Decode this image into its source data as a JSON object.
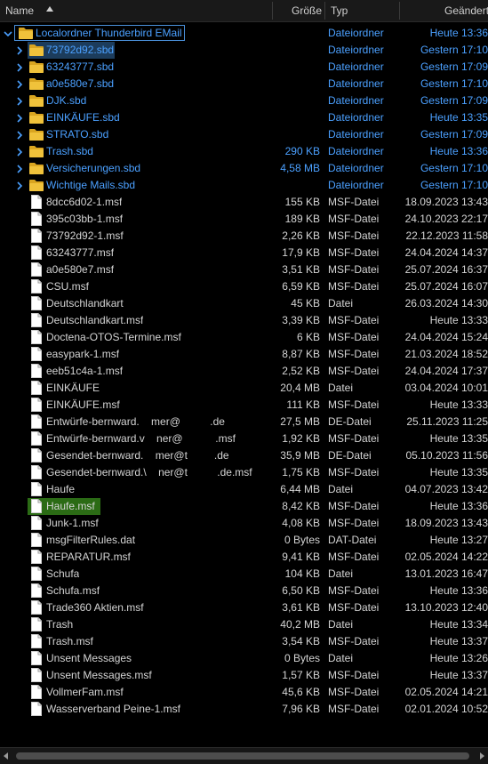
{
  "header": {
    "name": "Name",
    "size": "Größe",
    "type": "Typ",
    "modified": "Geändert"
  },
  "colors": {
    "folder": "#f0c23b",
    "folder_text": "#4ba0ff",
    "file_text": "#d4d4d4",
    "selection_green": "#2b6b15",
    "selection_blue": "#1c3c5c"
  },
  "rows": [
    {
      "name": "Localordner Thunderbird EMail",
      "size": "",
      "type": "Dateiordner",
      "date": "Heute 13:36",
      "kind": "folder",
      "level": 0,
      "expanded": true
    },
    {
      "name": "73792d92.sbd",
      "size": "",
      "type": "Dateiordner",
      "date": "Gestern 17:10",
      "kind": "folder",
      "level": 1
    },
    {
      "name": "63243777.sbd",
      "size": "",
      "type": "Dateiordner",
      "date": "Gestern 17:09",
      "kind": "folder",
      "level": 1
    },
    {
      "name": "a0e580e7.sbd",
      "size": "",
      "type": "Dateiordner",
      "date": "Gestern 17:10",
      "kind": "folder",
      "level": 1
    },
    {
      "name": "DJK.sbd",
      "size": "",
      "type": "Dateiordner",
      "date": "Gestern 17:09",
      "kind": "folder",
      "level": 1
    },
    {
      "name": "EINKÄUFE.sbd",
      "size": "",
      "type": "Dateiordner",
      "date": "Heute 13:35",
      "kind": "folder",
      "level": 1
    },
    {
      "name": "STRATO.sbd",
      "size": "",
      "type": "Dateiordner",
      "date": "Gestern 17:09",
      "kind": "folder",
      "level": 1
    },
    {
      "name": "Trash.sbd",
      "size": "290 KB",
      "type": "Dateiordner",
      "date": "Heute 13:36",
      "kind": "folder",
      "level": 1
    },
    {
      "name": "Versicherungen.sbd",
      "size": "4,58 MB",
      "type": "Dateiordner",
      "date": "Gestern 17:10",
      "kind": "folder",
      "level": 1
    },
    {
      "name": "Wichtige Mails.sbd",
      "size": "",
      "type": "Dateiordner",
      "date": "Gestern 17:10",
      "kind": "folder",
      "level": 1
    },
    {
      "name": "8dcc6d02-1.msf",
      "size": "155 KB",
      "type": "MSF-Datei",
      "date": "18.09.2023 13:43",
      "kind": "file"
    },
    {
      "name": "395c03bb-1.msf",
      "size": "189 KB",
      "type": "MSF-Datei",
      "date": "24.10.2023 22:17",
      "kind": "file"
    },
    {
      "name": "73792d92-1.msf",
      "size": "2,26 KB",
      "type": "MSF-Datei",
      "date": "22.12.2023 11:58",
      "kind": "file"
    },
    {
      "name": "63243777.msf",
      "size": "17,9 KB",
      "type": "MSF-Datei",
      "date": "24.04.2024 14:37",
      "kind": "file"
    },
    {
      "name": "a0e580e7.msf",
      "size": "3,51 KB",
      "type": "MSF-Datei",
      "date": "25.07.2024 16:37",
      "kind": "file"
    },
    {
      "name": "CSU.msf",
      "size": "6,59 KB",
      "type": "MSF-Datei",
      "date": "25.07.2024 16:07",
      "kind": "file"
    },
    {
      "name": "Deutschlandkart",
      "size": "45 KB",
      "type": "Datei",
      "date": "26.03.2024 14:30",
      "kind": "file"
    },
    {
      "name": "Deutschlandkart.msf",
      "size": "3,39 KB",
      "type": "MSF-Datei",
      "date": "Heute 13:33",
      "kind": "file"
    },
    {
      "name": "Doctena-OTOS-Termine.msf",
      "size": "6 KB",
      "type": "MSF-Datei",
      "date": "24.04.2024 15:24",
      "kind": "file"
    },
    {
      "name": "easypark-1.msf",
      "size": "8,87 KB",
      "type": "MSF-Datei",
      "date": "21.03.2024 18:52",
      "kind": "file"
    },
    {
      "name": "eeb51c4a-1.msf",
      "size": "2,52 KB",
      "type": "MSF-Datei",
      "date": "24.04.2024 17:37",
      "kind": "file"
    },
    {
      "name": "EINKÄUFE",
      "size": "20,4 MB",
      "type": "Datei",
      "date": "03.04.2024 10:01",
      "kind": "file"
    },
    {
      "name": "EINKÄUFE.msf",
      "size": "111 KB",
      "type": "MSF-Datei",
      "date": "Heute 13:33",
      "kind": "file"
    },
    {
      "name": "Entwürfe-bernward.    mer@          .de",
      "size": "27,5 MB",
      "type": "DE-Datei",
      "date": "25.11.2023 11:25",
      "kind": "file"
    },
    {
      "name": "Entwürfe-bernward.v    ner@           .msf",
      "size": "1,92 KB",
      "type": "MSF-Datei",
      "date": "Heute 13:35",
      "kind": "file"
    },
    {
      "name": "Gesendet-bernward.    mer@t         .de",
      "size": "35,9 MB",
      "type": "DE-Datei",
      "date": "05.10.2023 11:56",
      "kind": "file"
    },
    {
      "name": "Gesendet-bernward.\\    ner@t          .de.msf",
      "size": "1,75 KB",
      "type": "MSF-Datei",
      "date": "Heute 13:35",
      "kind": "file"
    },
    {
      "name": "Haufe",
      "size": "6,44 MB",
      "type": "Datei",
      "date": "04.07.2023 13:42",
      "kind": "file"
    },
    {
      "name": "Haufe.msf",
      "size": "8,42 KB",
      "type": "MSF-Datei",
      "date": "Heute 13:36",
      "kind": "file",
      "selected": true
    },
    {
      "name": "Junk-1.msf",
      "size": "4,08 KB",
      "type": "MSF-Datei",
      "date": "18.09.2023 13:43",
      "kind": "file"
    },
    {
      "name": "msgFilterRules.dat",
      "size": "0 Bytes",
      "type": "DAT-Datei",
      "date": "Heute 13:27",
      "kind": "file"
    },
    {
      "name": "REPARATUR.msf",
      "size": "9,41 KB",
      "type": "MSF-Datei",
      "date": "02.05.2024 14:22",
      "kind": "file"
    },
    {
      "name": "Schufa",
      "size": "104 KB",
      "type": "Datei",
      "date": "13.01.2023 16:47",
      "kind": "file"
    },
    {
      "name": "Schufa.msf",
      "size": "6,50 KB",
      "type": "MSF-Datei",
      "date": "Heute 13:36",
      "kind": "file"
    },
    {
      "name": "Trade360 Aktien.msf",
      "size": "3,61 KB",
      "type": "MSF-Datei",
      "date": "13.10.2023 12:40",
      "kind": "file"
    },
    {
      "name": "Trash",
      "size": "40,2 MB",
      "type": "Datei",
      "date": "Heute 13:34",
      "kind": "file"
    },
    {
      "name": "Trash.msf",
      "size": "3,54 KB",
      "type": "MSF-Datei",
      "date": "Heute 13:37",
      "kind": "file"
    },
    {
      "name": "Unsent Messages",
      "size": "0 Bytes",
      "type": "Datei",
      "date": "Heute 13:26",
      "kind": "file"
    },
    {
      "name": "Unsent Messages.msf",
      "size": "1,57 KB",
      "type": "MSF-Datei",
      "date": "Heute 13:37",
      "kind": "file"
    },
    {
      "name": "VollmerFam.msf",
      "size": "45,6 KB",
      "type": "MSF-Datei",
      "date": "02.05.2024 14:21",
      "kind": "file"
    },
    {
      "name": "Wasserverband Peine-1.msf",
      "size": "7,96 KB",
      "type": "MSF-Datei",
      "date": "02.01.2024 10:52",
      "kind": "file"
    }
  ]
}
